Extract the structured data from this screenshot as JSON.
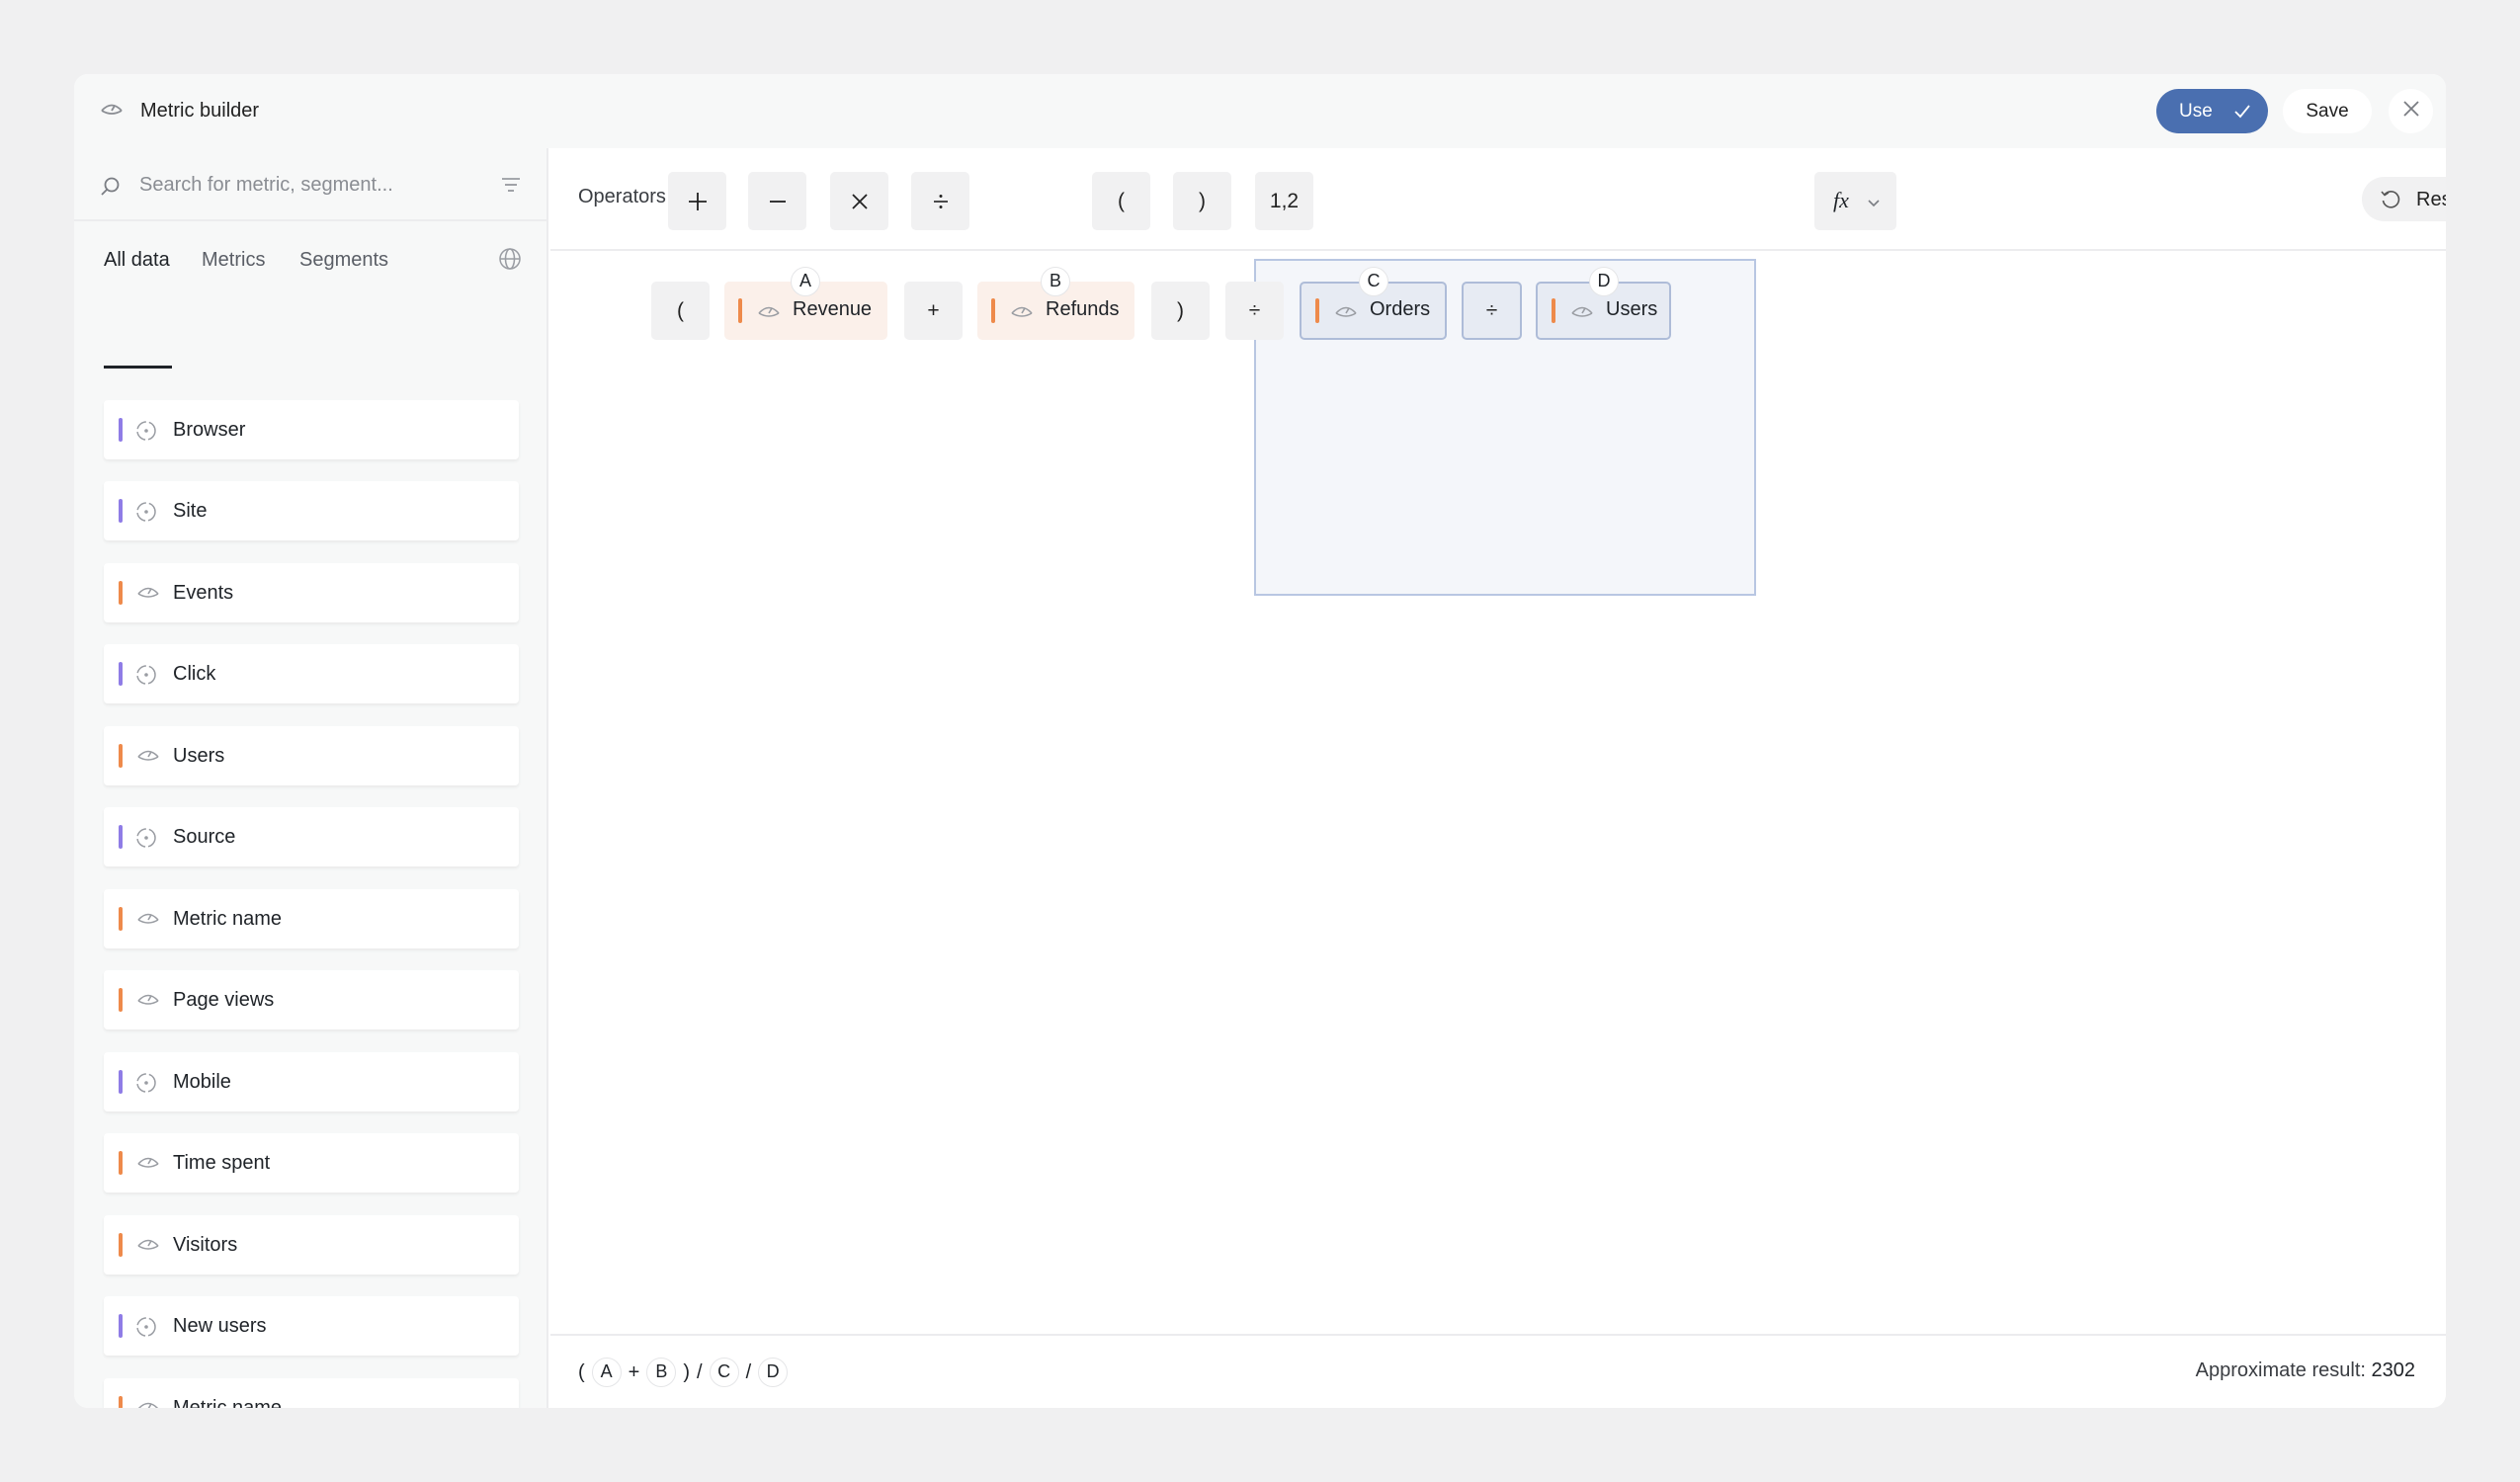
{
  "window": {
    "title": "Metric builder",
    "use_label": "Use",
    "save_label": "Save"
  },
  "sidebar": {
    "search_placeholder": "Search for metric, segment...",
    "tabs": [
      {
        "label": "All data",
        "active": true
      },
      {
        "label": "Metrics",
        "active": false
      },
      {
        "label": "Segments",
        "active": false
      }
    ],
    "items": [
      {
        "label": "Browser",
        "kind": "segment",
        "icon": "segment-icon"
      },
      {
        "label": "Site",
        "kind": "segment",
        "icon": "segment-icon"
      },
      {
        "label": "Events",
        "kind": "metric",
        "icon": "metric-icon"
      },
      {
        "label": "Click",
        "kind": "segment",
        "icon": "segment-icon"
      },
      {
        "label": "Users",
        "kind": "metric",
        "icon": "metric-icon"
      },
      {
        "label": "Source",
        "kind": "segment",
        "icon": "segment-icon"
      },
      {
        "label": "Metric name",
        "kind": "metric",
        "icon": "metric-icon"
      },
      {
        "label": "Page views",
        "kind": "metric",
        "icon": "metric-icon"
      },
      {
        "label": "Mobile",
        "kind": "segment",
        "icon": "segment-icon"
      },
      {
        "label": "Time spent",
        "kind": "metric",
        "icon": "metric-icon"
      },
      {
        "label": "Visitors",
        "kind": "metric",
        "icon": "metric-icon"
      },
      {
        "label": "New users",
        "kind": "segment",
        "icon": "segment-icon"
      },
      {
        "label": "Metric name",
        "kind": "metric",
        "icon": "metric-icon"
      }
    ]
  },
  "operators": {
    "label": "Operators",
    "buttons": [
      "+",
      "−",
      "×",
      "÷",
      "(",
      ")",
      "1,2"
    ],
    "fx_label": "fx",
    "reset_label": "Reset"
  },
  "expression": {
    "tokens": [
      {
        "type": "op",
        "text": "("
      },
      {
        "type": "metric",
        "badge": "A",
        "label": "Revenue"
      },
      {
        "type": "op",
        "text": "+"
      },
      {
        "type": "metric",
        "badge": "B",
        "label": "Refunds"
      },
      {
        "type": "op",
        "text": ")"
      },
      {
        "type": "op",
        "text": "÷"
      },
      {
        "type": "metric",
        "badge": "C",
        "label": "Orders",
        "selected": true
      },
      {
        "type": "op",
        "text": "÷",
        "selected": true
      },
      {
        "type": "metric",
        "badge": "D",
        "label": "Users",
        "selected": true
      }
    ]
  },
  "footer": {
    "formula": {
      "open": "(",
      "a": "A",
      "plus": "+",
      "b": "B",
      "close": ")",
      "slash1": "/",
      "c": "C",
      "slash2": "/",
      "d": "D"
    },
    "result_label": "Approximate result:",
    "result_value": "2302"
  },
  "colors": {
    "accent": "#4a6fb0",
    "metric_bar": "#ee8a4b",
    "segment_bar": "#8f7ce6"
  }
}
